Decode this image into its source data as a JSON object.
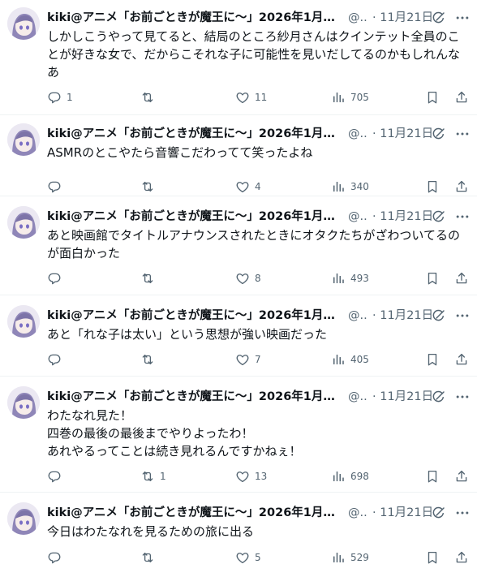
{
  "colors": {
    "text": "#0f1419",
    "secondary": "#536471",
    "separator": "#eff3f4"
  },
  "icons": {
    "reply": "reply-icon",
    "retweet": "retweet-icon",
    "like": "heart-icon",
    "views": "views-icon",
    "bookmark": "bookmark-icon",
    "share": "share-icon",
    "grok": "grok-icon",
    "more": "more-icon"
  },
  "tweets": [
    {
      "author": "kiki@アニメ「お前ごときが魔王に〜」2026年1月...",
      "handle": "@..",
      "date": "· 11月21日",
      "lines": [
        "しかしこうやって見てると、結局のところ紗月さんはクインテット全員のこ",
        "とが好きな女で、だからこそれな子に可能性を見いだしてるのかもしれんな",
        "あ"
      ],
      "replies": "1",
      "retweets": "",
      "likes": "11",
      "views": "705"
    },
    {
      "author": "kiki@アニメ「お前ごときが魔王に〜」2026年1月...",
      "handle": "@..",
      "date": "· 11月21日",
      "lines": [
        "ASMRのとこやたら音響こだわってて笑ったよね"
      ],
      "replies": "",
      "retweets": "",
      "likes": "4",
      "views": "340"
    },
    {
      "author": "kiki@アニメ「お前ごときが魔王に〜」2026年1月...",
      "handle": "@..",
      "date": "· 11月21日",
      "lines": [
        "あと映画館でタイトルアナウンスされたときにオタクたちがざわついてるの",
        "が面白かった"
      ],
      "replies": "",
      "retweets": "",
      "likes": "8",
      "views": "493"
    },
    {
      "author": "kiki@アニメ「お前ごときが魔王に〜」2026年1月...",
      "handle": "@..",
      "date": "· 11月21日",
      "lines": [
        "あと「れな子は太い」という思想が強い映画だった"
      ],
      "replies": "",
      "retweets": "",
      "likes": "7",
      "views": "405"
    },
    {
      "author": "kiki@アニメ「お前ごときが魔王に〜」2026年1月...",
      "handle": "@..",
      "date": "· 11月21日",
      "lines": [
        "わたなれ見た！",
        "四巻の最後の最後までやりよったわ！",
        "あれやるってことは続き見れるんですかねぇ！"
      ],
      "replies": "",
      "retweets": "1",
      "likes": "13",
      "views": "698"
    },
    {
      "author": "kiki@アニメ「お前ごときが魔王に〜」2026年1月...",
      "handle": "@..",
      "date": "· 11月21日",
      "lines": [
        "今日はわたなれを見るための旅に出る"
      ],
      "replies": "",
      "retweets": "",
      "likes": "5",
      "views": "529"
    }
  ]
}
